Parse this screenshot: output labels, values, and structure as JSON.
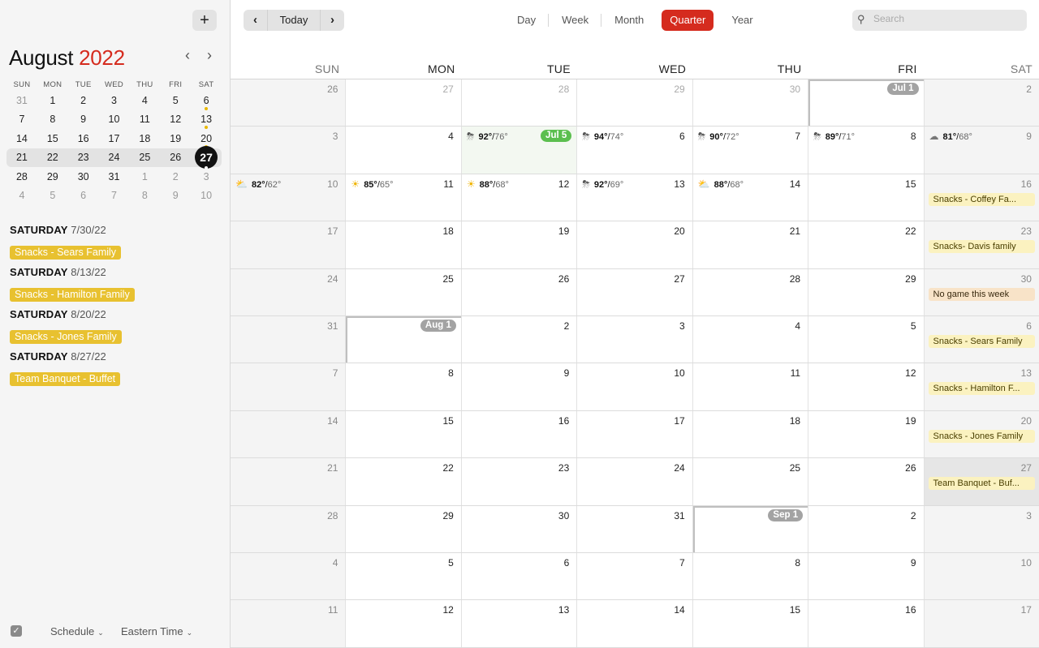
{
  "sidebar": {
    "add_label": "+",
    "mini_month": "August",
    "mini_year": "2022",
    "prev": "‹",
    "next": "›",
    "weekdays": [
      "SUN",
      "MON",
      "TUE",
      "WED",
      "THU",
      "FRI",
      "SAT"
    ],
    "weeks": [
      [
        {
          "d": "31",
          "o": true
        },
        {
          "d": "1"
        },
        {
          "d": "2"
        },
        {
          "d": "3"
        },
        {
          "d": "4"
        },
        {
          "d": "5"
        },
        {
          "d": "6",
          "dot": true
        }
      ],
      [
        {
          "d": "7"
        },
        {
          "d": "8"
        },
        {
          "d": "9"
        },
        {
          "d": "10"
        },
        {
          "d": "11"
        },
        {
          "d": "12"
        },
        {
          "d": "13",
          "dot": true
        }
      ],
      [
        {
          "d": "14"
        },
        {
          "d": "15"
        },
        {
          "d": "16"
        },
        {
          "d": "17"
        },
        {
          "d": "18"
        },
        {
          "d": "19"
        },
        {
          "d": "20",
          "dot": true
        }
      ],
      [
        {
          "d": "21"
        },
        {
          "d": "22"
        },
        {
          "d": "23"
        },
        {
          "d": "24"
        },
        {
          "d": "25"
        },
        {
          "d": "26"
        },
        {
          "d": "27",
          "today": true,
          "dot": true
        }
      ],
      [
        {
          "d": "28"
        },
        {
          "d": "29"
        },
        {
          "d": "30"
        },
        {
          "d": "31"
        },
        {
          "d": "1",
          "o": true
        },
        {
          "d": "2",
          "o": true
        },
        {
          "d": "3",
          "o": true
        }
      ],
      [
        {
          "d": "4",
          "o": true
        },
        {
          "d": "5",
          "o": true
        },
        {
          "d": "6",
          "o": true
        },
        {
          "d": "7",
          "o": true
        },
        {
          "d": "8",
          "o": true
        },
        {
          "d": "9",
          "o": true
        },
        {
          "d": "10",
          "o": true
        }
      ]
    ],
    "schedule": [
      {
        "day": "SATURDAY",
        "date": "7/30/22",
        "event": "Snacks - Sears Family"
      },
      {
        "day": "SATURDAY",
        "date": "8/13/22",
        "event": "Snacks - Hamilton Family"
      },
      {
        "day": "SATURDAY",
        "date": "8/20/22",
        "event": "Snacks - Jones Family"
      },
      {
        "day": "SATURDAY",
        "date": "8/27/22",
        "event": "Team Banquet - Buffet"
      }
    ],
    "footer": {
      "check": "✓",
      "schedule": "Schedule",
      "timezone": "Eastern Time"
    }
  },
  "toolbar": {
    "prev": "‹",
    "today": "Today",
    "next": "›",
    "views": [
      "Day",
      "Week",
      "Month",
      "Quarter",
      "Year"
    ],
    "active_view": "Quarter",
    "search_placeholder": "Search",
    "search_icon": "search-icon"
  },
  "colors": {
    "accent": "#d52b1e",
    "event_yellow": "#e8c130",
    "badge_green": "#5bbf4f"
  },
  "day_headers": [
    "SUN",
    "MON",
    "TUE",
    "WED",
    "THU",
    "FRI",
    "SAT"
  ],
  "weeks": [
    [
      {
        "d": "26",
        "dim": true
      },
      {
        "d": "27",
        "dim": true
      },
      {
        "d": "28",
        "dim": true
      },
      {
        "d": "29",
        "dim": true
      },
      {
        "d": "30",
        "dim": true
      },
      {
        "d": "",
        "badge": "Jul 1"
      },
      {
        "d": "2"
      }
    ],
    [
      {
        "d": "3"
      },
      {
        "d": "4"
      },
      {
        "d": "",
        "badge": "Jul 5",
        "badge_color": "green",
        "wx": {
          "icon": "thunderstorm-icon",
          "hi": "92°",
          "lo": "76°"
        },
        "hl": true
      },
      {
        "d": "6",
        "wx": {
          "icon": "thunderstorm-icon",
          "hi": "94°",
          "lo": "74°"
        }
      },
      {
        "d": "7",
        "wx": {
          "icon": "thunderstorm-icon",
          "hi": "90°",
          "lo": "72°"
        }
      },
      {
        "d": "8",
        "wx": {
          "icon": "thunderstorm-icon",
          "hi": "89°",
          "lo": "71°"
        }
      },
      {
        "d": "9",
        "wx": {
          "icon": "cloud-icon",
          "hi": "81°",
          "lo": "68°"
        }
      }
    ],
    [
      {
        "d": "10",
        "wx": {
          "icon": "partly-cloudy-icon",
          "hi": "82°",
          "lo": "62°"
        }
      },
      {
        "d": "11",
        "wx": {
          "icon": "sun-icon",
          "hi": "85°",
          "lo": "65°"
        }
      },
      {
        "d": "12",
        "wx": {
          "icon": "sun-icon",
          "hi": "88°",
          "lo": "68°"
        }
      },
      {
        "d": "13",
        "wx": {
          "icon": "thunderstorm-icon",
          "hi": "92°",
          "lo": "69°"
        }
      },
      {
        "d": "14",
        "wx": {
          "icon": "partly-cloudy-icon",
          "hi": "88°",
          "lo": "68°"
        }
      },
      {
        "d": "15"
      },
      {
        "d": "16",
        "ev": "Snacks - Coffey Fa..."
      }
    ],
    [
      {
        "d": "17"
      },
      {
        "d": "18"
      },
      {
        "d": "19"
      },
      {
        "d": "20"
      },
      {
        "d": "21"
      },
      {
        "d": "22"
      },
      {
        "d": "23",
        "ev": "Snacks- Davis family"
      }
    ],
    [
      {
        "d": "24"
      },
      {
        "d": "25"
      },
      {
        "d": "26"
      },
      {
        "d": "27"
      },
      {
        "d": "28"
      },
      {
        "d": "29"
      },
      {
        "d": "30",
        "ev": "No game this week",
        "ev_color": "orange"
      }
    ],
    [
      {
        "d": "31"
      },
      {
        "d": "",
        "badge": "Aug 1"
      },
      {
        "d": "2"
      },
      {
        "d": "3"
      },
      {
        "d": "4"
      },
      {
        "d": "5"
      },
      {
        "d": "6",
        "ev": "Snacks - Sears Family"
      }
    ],
    [
      {
        "d": "7"
      },
      {
        "d": "8"
      },
      {
        "d": "9"
      },
      {
        "d": "10"
      },
      {
        "d": "11"
      },
      {
        "d": "12"
      },
      {
        "d": "13",
        "ev": "Snacks - Hamilton F..."
      }
    ],
    [
      {
        "d": "14"
      },
      {
        "d": "15"
      },
      {
        "d": "16"
      },
      {
        "d": "17"
      },
      {
        "d": "18"
      },
      {
        "d": "19"
      },
      {
        "d": "20",
        "ev": "Snacks - Jones Family"
      }
    ],
    [
      {
        "d": "21"
      },
      {
        "d": "22"
      },
      {
        "d": "23"
      },
      {
        "d": "24"
      },
      {
        "d": "25"
      },
      {
        "d": "26"
      },
      {
        "d": "27",
        "ev": "Team Banquet - Buf...",
        "sel": true
      }
    ],
    [
      {
        "d": "28"
      },
      {
        "d": "29"
      },
      {
        "d": "30"
      },
      {
        "d": "31"
      },
      {
        "d": "",
        "badge": "Sep 1"
      },
      {
        "d": "2"
      },
      {
        "d": "3"
      }
    ],
    [
      {
        "d": "4"
      },
      {
        "d": "5"
      },
      {
        "d": "6"
      },
      {
        "d": "7"
      },
      {
        "d": "8"
      },
      {
        "d": "9"
      },
      {
        "d": "10"
      }
    ],
    [
      {
        "d": "11"
      },
      {
        "d": "12"
      },
      {
        "d": "13"
      },
      {
        "d": "14"
      },
      {
        "d": "15"
      },
      {
        "d": "16"
      },
      {
        "d": "17"
      }
    ]
  ]
}
